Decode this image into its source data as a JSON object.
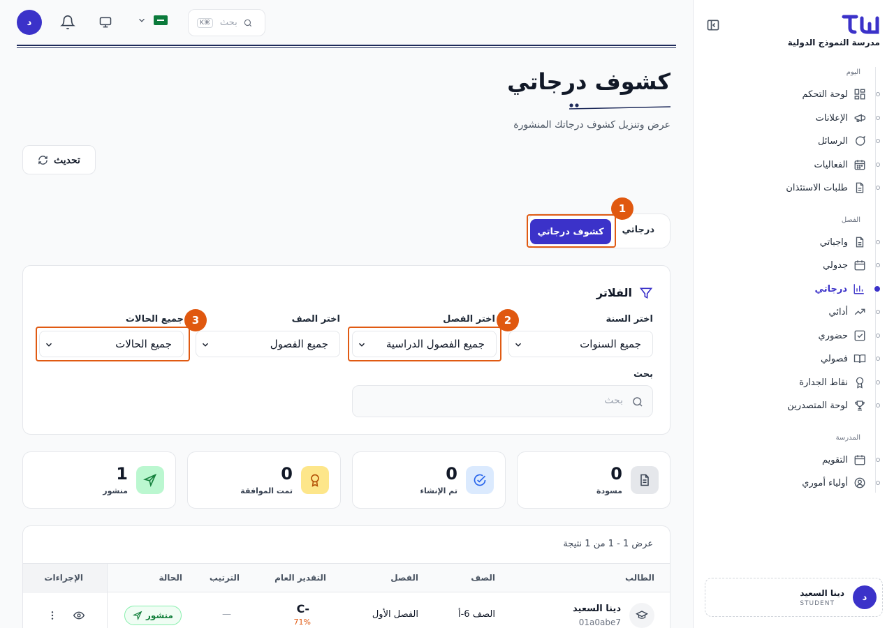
{
  "topbar": {
    "avatar_letter": "د",
    "search_placeholder": "بحث",
    "search_shortcut": "K⌘"
  },
  "header": {
    "title": "كشوف درجاتي",
    "subtitle": "عرض وتنزيل كشوف درجاتك المنشورة",
    "refresh_label": "تحديث"
  },
  "tabs": [
    {
      "label": "درجاتي"
    },
    {
      "label": "كشوف درجاتي",
      "active": true
    }
  ],
  "markers": [
    "1",
    "2",
    "3"
  ],
  "filters": {
    "title": "الفلاتر",
    "year": {
      "label": "اختر السنة",
      "value": "جميع السنوات"
    },
    "term": {
      "label": "اختر الفصل",
      "value": "جميع الفصول الدراسية"
    },
    "grade": {
      "label": "اختر الصف",
      "value": "جميع الفصول"
    },
    "status": {
      "label": "جميع الحالات",
      "value": "جميع الحالات"
    },
    "search": {
      "label": "بحث",
      "placeholder": "بحث"
    }
  },
  "stats": [
    {
      "value": "0",
      "label": "مسودة",
      "icon": "document-icon"
    },
    {
      "value": "0",
      "label": "تم الإنشاء",
      "icon": "check-circle-icon"
    },
    {
      "value": "0",
      "label": "تمت الموافقة",
      "icon": "award-icon"
    },
    {
      "value": "1",
      "label": "منشور",
      "icon": "send-icon"
    }
  ],
  "table": {
    "results_text": "عرض 1 - 1 من 1 نتيجة",
    "columns": [
      "الطالب",
      "الصف",
      "الفصل",
      "التقدير العام",
      "الترتيب",
      "الحالة",
      "الإجراءات"
    ],
    "rows": [
      {
        "student": "دينا السعيد",
        "student_id": "01a0abe7",
        "grade": "الصف 6-أ",
        "term": "الفصل الأول",
        "overall": "-C",
        "percent": "71%",
        "rank": "—",
        "status": "منشور"
      }
    ]
  },
  "sidebar": {
    "school_name": "مدرسة النموذج الدولية",
    "sections": [
      {
        "label": "اليوم",
        "items": [
          "لوحة التحكم",
          "الإعلانات",
          "الرسائل",
          "الفعاليات",
          "طلبات الاستئذان"
        ]
      },
      {
        "label": "الفصل",
        "items": [
          "واجباتي",
          "جدولي",
          "درجاتي",
          "أدائي",
          "حضوري",
          "فصولي",
          "نقاط الجدارة",
          "لوحة المتصدرين"
        ]
      },
      {
        "label": "المدرسة",
        "items": [
          "التقويم",
          "أولياء أموري"
        ]
      }
    ],
    "active_item": "درجاتي",
    "user": {
      "name": "دينا السعيد",
      "role": "STUDENT",
      "initial": "د"
    }
  },
  "colors": {
    "accent": "#3b32c9",
    "highlight": "#e05a12",
    "success": "#15803d"
  }
}
